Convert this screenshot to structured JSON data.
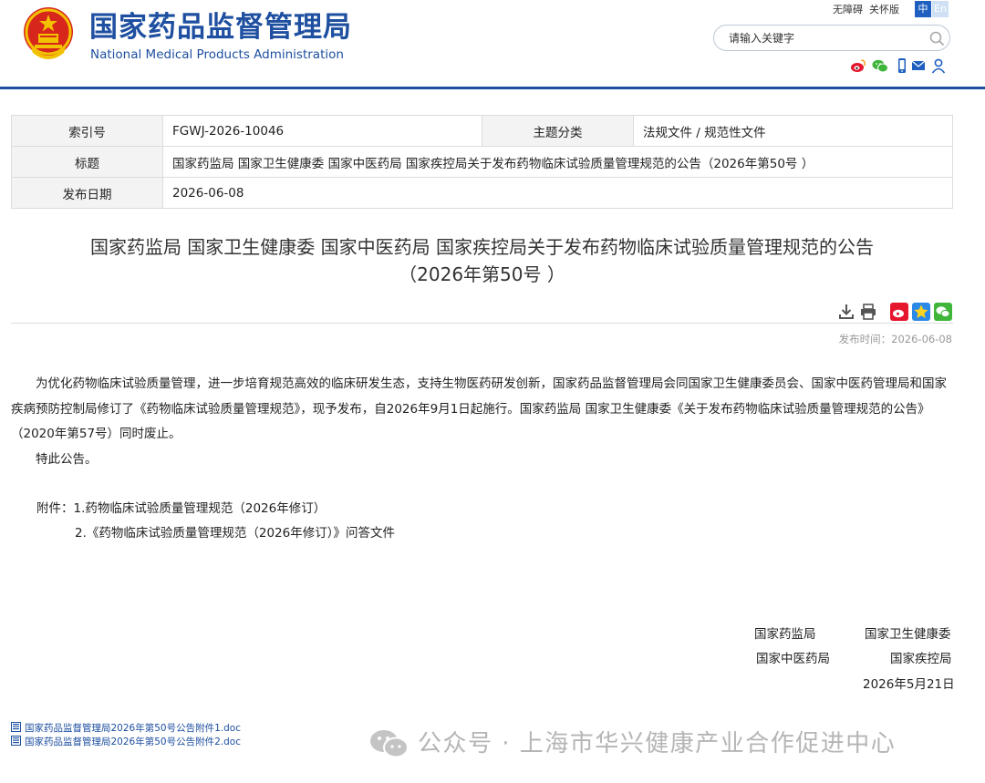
{
  "header": {
    "title_cn": "国家药品监督管理局",
    "title_en": "National Medical Products Administration",
    "top_links": [
      "无障碍",
      "关怀版"
    ],
    "lang": {
      "zh": "中",
      "en": "En"
    },
    "search": {
      "placeholder": "请输入关键字"
    },
    "social_icons": [
      "weibo-icon",
      "wechat-icon",
      "mobile-icon",
      "mail-icon",
      "user-icon"
    ]
  },
  "meta": {
    "index_label": "索引号",
    "index_value": "FGWJ-2026-10046",
    "topic_label": "主题分类",
    "topic_value": "法规文件 / 规范性文件",
    "title_label": "标题",
    "title_value": "国家药监局 国家卫生健康委 国家中医药局 国家疾控局关于发布药物临床试验质量管理规范的公告（2026年第50号 ）",
    "date_label": "发布日期",
    "date_value": "2026-06-08"
  },
  "article": {
    "title_line1": "国家药监局 国家卫生健康委 国家中医药局 国家疾控局关于发布药物临床试验质量管理规范的公告",
    "title_line2": "（2026年第50号 ）",
    "tool_icons": [
      "download-icon",
      "print-icon",
      "weibo-share-icon",
      "qzone-share-icon",
      "wechat-share-icon"
    ],
    "publish_time_label": "发布时间：",
    "publish_time_value": "2026-06-08",
    "paragraph1": "为优化药物临床试验质量管理，进一步培育规范高效的临床研发生态，支持生物医药研发创新，国家药品监督管理局会同国家卫生健康委员会、国家中医药管理局和国家疾病预防控制局修订了《药物临床试验质量管理规范》，现予发布，自2026年9月1日起施行。国家药监局 国家卫生健康委《关于发布药物临床试验质量管理规范的公告》（2020年第57号）同时废止。",
    "paragraph2": "特此公告。",
    "attachment1": "附件：1.药物临床试验质量管理规范（2026年修订）",
    "attachment2": "2.《药物临床试验质量管理规范（2026年修订）》问答文件",
    "signatures": {
      "org1": "国家药监局",
      "org2": "国家卫生健康委",
      "org3": "国家中医药局",
      "org4": "国家疾控局",
      "date": "2026年5月21日"
    },
    "files": [
      "国家药品监督管理局2026年第50号公告附件1.doc",
      "国家药品监督管理局2026年第50号公告附件2.doc"
    ]
  },
  "watermark": {
    "text": "公众号 · 上海市华兴健康产业合作促进中心"
  },
  "colors": {
    "brand_blue": "#1e4fa0",
    "emblem_red": "#d7261b",
    "emblem_gold": "#f2c200"
  }
}
